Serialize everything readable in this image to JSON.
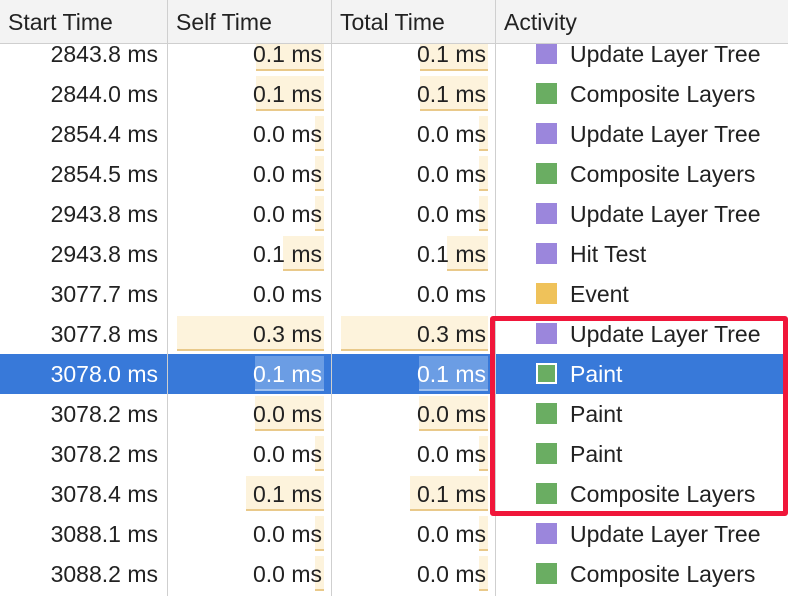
{
  "columns": {
    "start": "Start Time",
    "self": "Self Time",
    "total": "Total Time",
    "activity": "Activity"
  },
  "colors": {
    "Rendering": "#9b86dc",
    "Painting": "#6aad62",
    "Scripting": "#efc25a",
    "selected_row": "#3879d9",
    "highlight_box": "#f0163a"
  },
  "rows": [
    {
      "start": "2843.8 ms",
      "self": "0.1 ms",
      "total": "0.1 ms",
      "activity": "Update Layer Tree",
      "category": "Rendering",
      "self_bar": 0.45,
      "total_bar": 0.45
    },
    {
      "start": "2844.0 ms",
      "self": "0.1 ms",
      "total": "0.1 ms",
      "activity": "Composite Layers",
      "category": "Painting",
      "self_bar": 0.45,
      "total_bar": 0.45
    },
    {
      "start": "2854.4 ms",
      "self": "0.0 ms",
      "total": "0.0 ms",
      "activity": "Update Layer Tree",
      "category": "Rendering",
      "self_bar": 0.06,
      "total_bar": 0.06
    },
    {
      "start": "2854.5 ms",
      "self": "0.0 ms",
      "total": "0.0 ms",
      "activity": "Composite Layers",
      "category": "Painting",
      "self_bar": 0.06,
      "total_bar": 0.06
    },
    {
      "start": "2943.8 ms",
      "self": "0.0 ms",
      "total": "0.0 ms",
      "activity": "Update Layer Tree",
      "category": "Rendering",
      "self_bar": 0.06,
      "total_bar": 0.06
    },
    {
      "start": "2943.8 ms",
      "self": "0.1 ms",
      "total": "0.1 ms",
      "activity": "Hit Test",
      "category": "Rendering",
      "self_bar": 0.27,
      "total_bar": 0.27
    },
    {
      "start": "3077.7 ms",
      "self": "0.0 ms",
      "total": "0.0 ms",
      "activity": "Event",
      "category": "Scripting",
      "self_bar": 0.0,
      "total_bar": 0.0
    },
    {
      "start": "3077.8 ms",
      "self": "0.3 ms",
      "total": "0.3 ms",
      "activity": "Update Layer Tree",
      "category": "Rendering",
      "self_bar": 0.98,
      "total_bar": 0.98
    },
    {
      "start": "3078.0 ms",
      "self": "0.1 ms",
      "total": "0.1 ms",
      "activity": "Paint",
      "category": "Painting",
      "self_bar": 0.46,
      "total_bar": 0.46,
      "selected": true
    },
    {
      "start": "3078.2 ms",
      "self": "0.0 ms",
      "total": "0.0 ms",
      "activity": "Paint",
      "category": "Painting",
      "self_bar": 0.46,
      "total_bar": 0.46
    },
    {
      "start": "3078.2 ms",
      "self": "0.0 ms",
      "total": "0.0 ms",
      "activity": "Paint",
      "category": "Painting",
      "self_bar": 0.06,
      "total_bar": 0.06
    },
    {
      "start": "3078.4 ms",
      "self": "0.1 ms",
      "total": "0.1 ms",
      "activity": "Composite Layers",
      "category": "Painting",
      "self_bar": 0.52,
      "total_bar": 0.52
    },
    {
      "start": "3088.1 ms",
      "self": "0.0 ms",
      "total": "0.0 ms",
      "activity": "Update Layer Tree",
      "category": "Rendering",
      "self_bar": 0.06,
      "total_bar": 0.06
    },
    {
      "start": "3088.2 ms",
      "self": "0.0 ms",
      "total": "0.0 ms",
      "activity": "Composite Layers",
      "category": "Painting",
      "self_bar": 0.06,
      "total_bar": 0.06
    }
  ]
}
